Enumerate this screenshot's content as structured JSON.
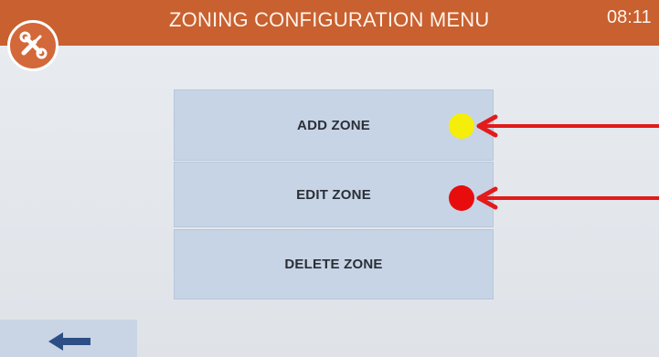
{
  "header": {
    "title": "ZONING CONFIGURATION MENU",
    "time": "08:11",
    "color": "#c8602f"
  },
  "settings_button": {
    "icon": "wrench-screwdriver-icon"
  },
  "menu": {
    "items": [
      {
        "label": "ADD ZONE"
      },
      {
        "label": "EDIT ZONE"
      },
      {
        "label": "DELETE ZONE"
      }
    ]
  },
  "annotations": {
    "markers": [
      {
        "target": "ADD ZONE",
        "color": "#f4ee0a"
      },
      {
        "target": "EDIT ZONE",
        "color": "#e80d0d"
      }
    ],
    "arrow_color": "#e21b1b"
  },
  "footer": {
    "back_icon": "arrow-left-icon"
  },
  "colors": {
    "screen_bg": "#e7eaee",
    "button_bg": "#c7d4e6",
    "button_text": "#2a2f36"
  }
}
